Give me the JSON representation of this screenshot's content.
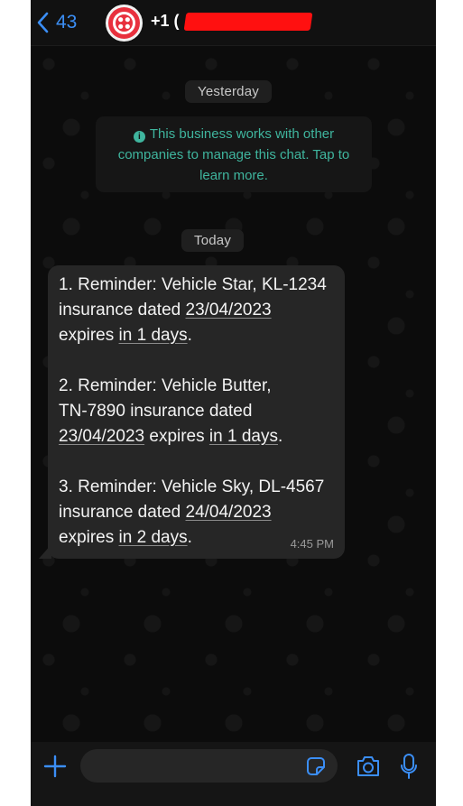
{
  "header": {
    "back_count": "43",
    "contact_name_prefix": "+1 ("
  },
  "chat": {
    "date_chips": [
      "Yesterday",
      "Today"
    ],
    "business_notice": {
      "line1": "This business works with other",
      "line2": "companies to manage this chat. Tap to",
      "line3": "learn more."
    },
    "message": {
      "lines": [
        [
          "1. Reminder: Vehicle Star, KL-1234"
        ],
        [
          "insurance dated ",
          "23/04/2023"
        ],
        [
          "expires ",
          "in 1 days",
          "."
        ],
        [
          "2. Reminder: Vehicle Butter,"
        ],
        [
          "TN-7890 insurance dated"
        ],
        [
          "23/04/2023",
          " expires ",
          "in 1 days",
          "."
        ],
        [
          "3. Reminder: Vehicle Sky, DL-4567"
        ],
        [
          "insurance dated ",
          "24/04/2023"
        ],
        [
          "expires ",
          "in 2 days",
          "."
        ]
      ],
      "time": "4:45 PM"
    }
  },
  "input_bar": {
    "placeholder": ""
  },
  "icons": {
    "back": "chevron-left-icon",
    "info": "info-icon",
    "plus": "plus-icon",
    "sticker": "sticker-icon",
    "camera": "camera-icon",
    "mic": "microphone-icon"
  },
  "colors": {
    "accent_blue": "#3b8ef5",
    "notice_green": "#3fb59e",
    "avatar_red": "#e8303d",
    "bubble": "#262626",
    "redaction": "#ff1010"
  }
}
